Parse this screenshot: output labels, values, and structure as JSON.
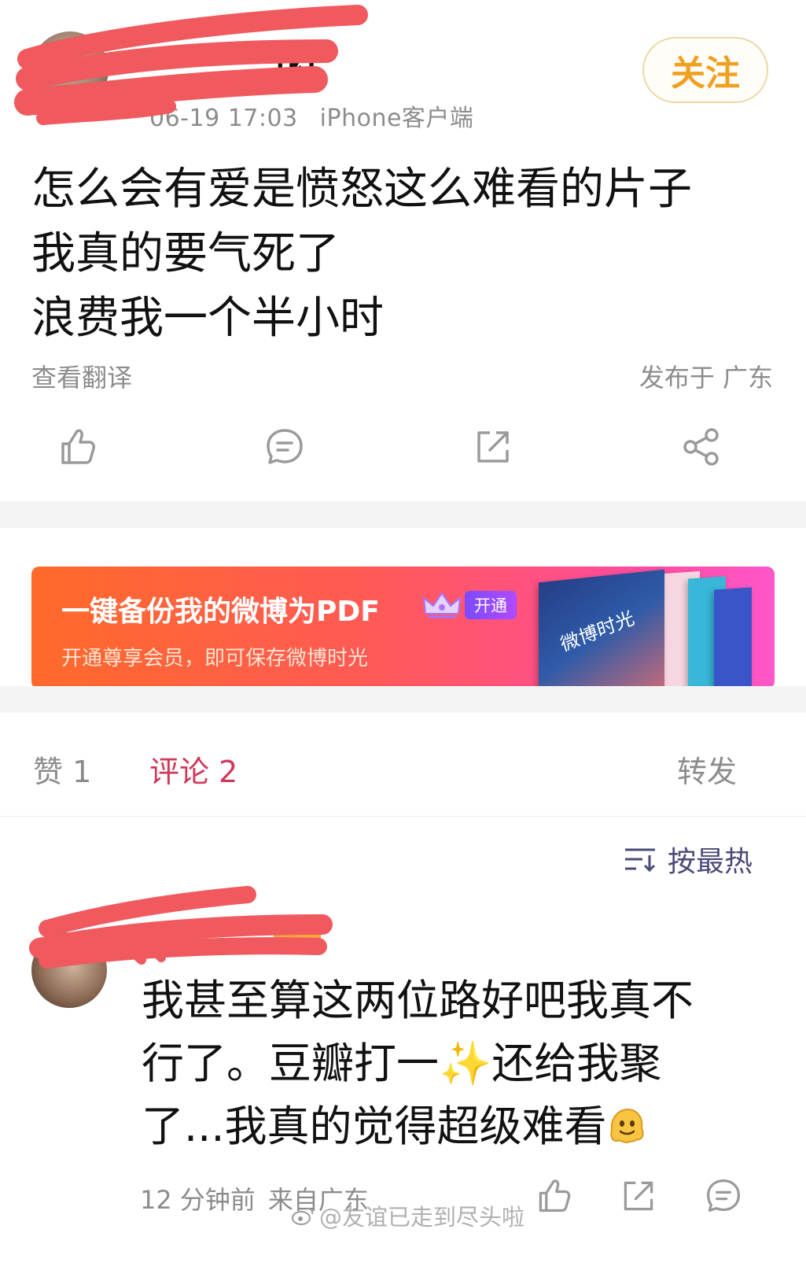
{
  "post": {
    "username_visible": "的",
    "time": "06-19 17:03",
    "client": "iPhone客户端",
    "follow_label": "关注",
    "lines": [
      "怎么会有爱是愤怒这么难看的片子",
      "我真的要气死了",
      "浪费我一个半小时"
    ],
    "translate_label": "查看翻译",
    "location": "发布于 广东",
    "actions": [
      "like-icon",
      "comment-icon",
      "repost-icon",
      "share-icon"
    ]
  },
  "banner": {
    "title": "一键备份我的微博为PDF",
    "badge": "开通",
    "subtitle": "开通尊享会员，即可保存微博时光",
    "book_title": "微博时光"
  },
  "tabs": {
    "likes": "赞 1",
    "comments": "评论 2",
    "reposts": "转发"
  },
  "sort": {
    "label": "按最热"
  },
  "comment": {
    "line1": "我甚至算这两位路好吧我真不",
    "line2_a": "行了。豆瓣打一",
    "line2_emoji": "✨",
    "line2_b": "还给我聚",
    "line3": "了...我真的觉得超级难看",
    "time": "12 分钟前",
    "from": "来自广东"
  },
  "watermark": "@友谊已走到尽头啦",
  "colors": {
    "accent_follow": "#f0a020",
    "active_tab": "#d0385a",
    "muted_text": "#8c8c8c",
    "redaction": "#f05a5e"
  }
}
